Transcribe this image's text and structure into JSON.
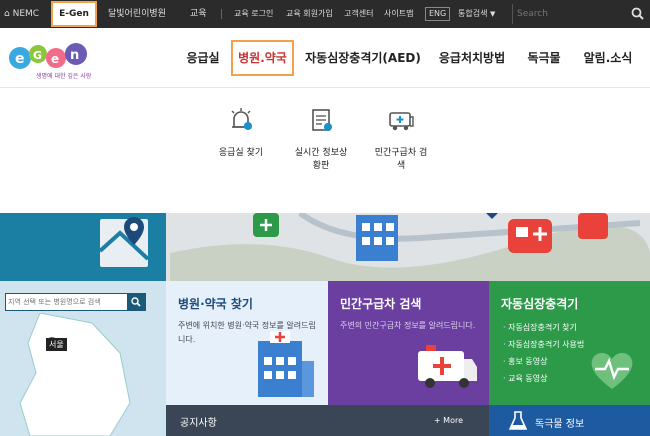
{
  "topbar": {
    "nemc": "NEMC",
    "egen": "E-Gen",
    "kids_hospital": "달빛어린이병원",
    "education": "교육",
    "edu_login": "교육 로그인",
    "edu_signup": "교육 회원가입",
    "customer_center": "고객센터",
    "sitemap": "사이트맵",
    "eng": "ENG",
    "integrated_search": "통합검색",
    "search_placeholder": "Search"
  },
  "logo": {
    "tagline": "생명에 대한 깊은 사랑"
  },
  "nav": {
    "items": [
      "응급실",
      "병원.약국",
      "자동심장충격기(AED)",
      "응급처치방법",
      "독극물",
      "알림.소식"
    ]
  },
  "submenu": {
    "items": [
      "응급실 찾기",
      "실시간 정보상\n황판",
      "민간구급차 검\n색"
    ]
  },
  "region": {
    "placeholder": "지역 선택 또는 병원명으로 검색",
    "seoul": "서울"
  },
  "cards": {
    "hospital": {
      "title": "병원·약국 찾기",
      "desc": "주변에 위치한 병원·약국 정보를 알려드립니다."
    },
    "ambulance": {
      "title": "민간구급차 검색",
      "desc": "주변의 민간구급차 정보를 알려드립니다."
    },
    "aed": {
      "title": "자동심장충격기",
      "items": [
        "· 자동심장충격기 찾기",
        "· 자동심장충격기 사용법",
        "· 홍보 동영상",
        "· 교육 동영상"
      ]
    }
  },
  "notice": {
    "title": "공지사항",
    "more": "+ More"
  },
  "poison": {
    "title": "독극물 정보"
  },
  "colors": {
    "accent": "#f5a04a",
    "aed_green": "#2d9a4a",
    "amb_purple": "#6a3fa0",
    "map_teal": "#1a7fa3"
  }
}
